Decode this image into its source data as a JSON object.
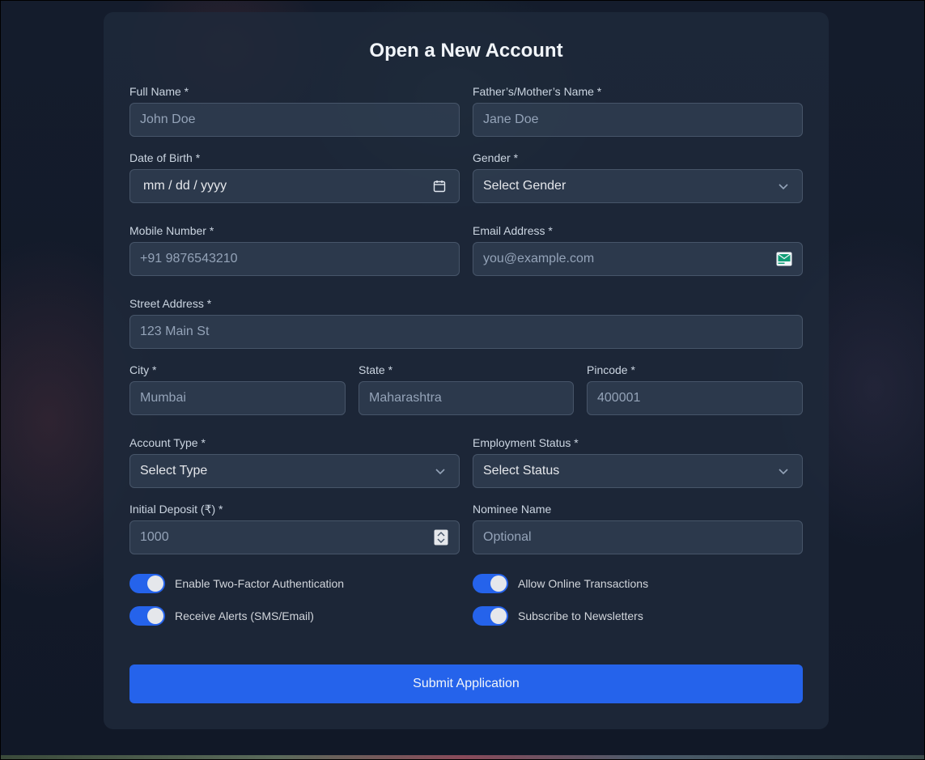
{
  "form": {
    "title": "Open a New Account",
    "full_name": {
      "label": "Full Name *",
      "placeholder": "John Doe"
    },
    "parent_name": {
      "label": "Father’s/Mother’s Name *",
      "placeholder": "Jane Doe"
    },
    "dob": {
      "label": "Date of Birth *",
      "value": "mm / dd / yyyy",
      "icon": "calendar-icon"
    },
    "gender": {
      "label": "Gender *",
      "value": "Select Gender",
      "icon": "chevron-down-icon"
    },
    "mobile": {
      "label": "Mobile Number *",
      "placeholder": "+91 9876543210"
    },
    "email": {
      "label": "Email Address *",
      "placeholder": "you@example.com",
      "icon": "email-autofill-icon"
    },
    "street": {
      "label": "Street Address *",
      "placeholder": "123 Main St"
    },
    "city": {
      "label": "City *",
      "placeholder": "Mumbai"
    },
    "state": {
      "label": "State *",
      "placeholder": "Maharashtra"
    },
    "pincode": {
      "label": "Pincode *",
      "placeholder": "400001"
    },
    "account_type": {
      "label": "Account Type *",
      "value": "Select Type",
      "icon": "chevron-down-icon"
    },
    "employment": {
      "label": "Employment Status *",
      "value": "Select Status",
      "icon": "chevron-down-icon"
    },
    "deposit": {
      "label": "Initial Deposit (₹) *",
      "placeholder": "1000",
      "icon": "spinner-icon"
    },
    "nominee": {
      "label": "Nominee Name",
      "placeholder": "Optional"
    },
    "toggles": {
      "two_factor": {
        "label": "Enable Two-Factor Authentication",
        "on": true
      },
      "online_tx": {
        "label": "Allow Online Transactions",
        "on": true
      },
      "alerts": {
        "label": "Receive Alerts (SMS/Email)",
        "on": true
      },
      "newsletter": {
        "label": "Subscribe to Newsletters",
        "on": true
      }
    },
    "submit_label": "Submit Application"
  },
  "colors": {
    "accent": "#2563eb",
    "card": "#1e293b",
    "input_bg": "#334155",
    "text": "#f1f5f9"
  }
}
